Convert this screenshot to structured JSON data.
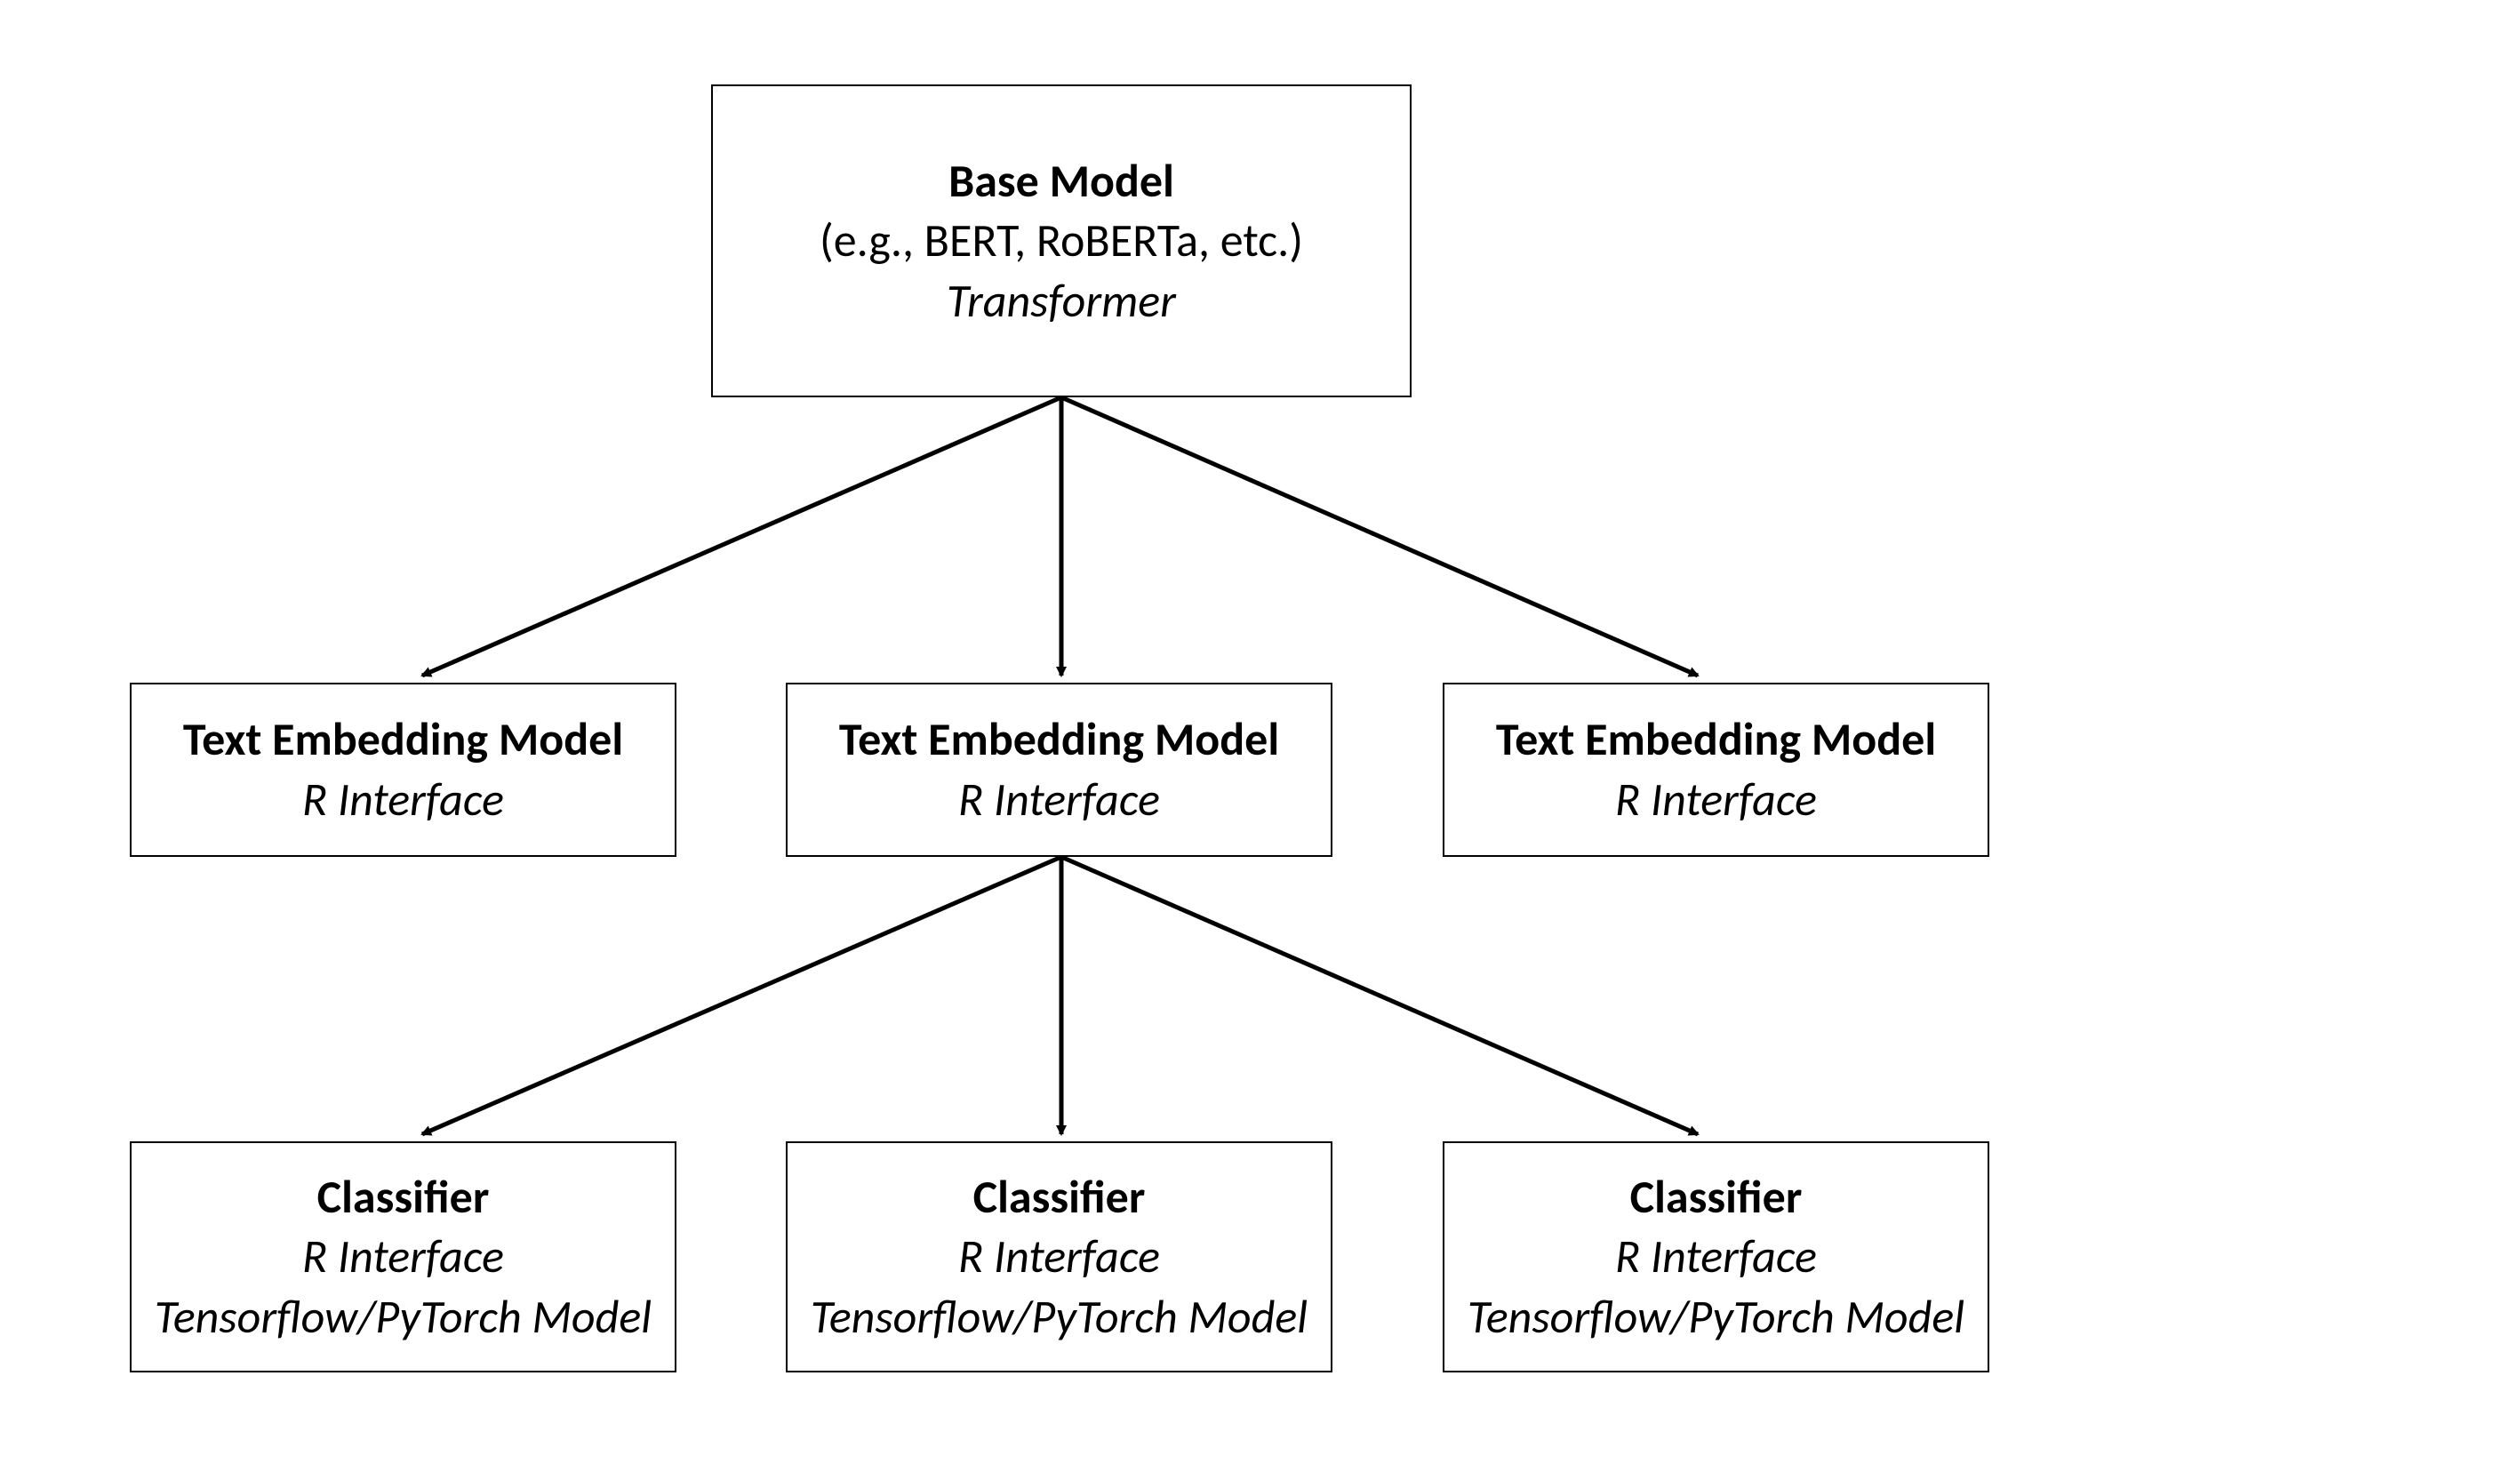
{
  "nodes": {
    "base": {
      "title": "Base Model",
      "subtitle": "(e.g., BERT, RoBERTa, etc.)",
      "italic": "Transformer"
    },
    "embed1": {
      "title": "Text Embedding Model",
      "italic": "R Interface"
    },
    "embed2": {
      "title": "Text Embedding Model",
      "italic": "R Interface"
    },
    "embed3": {
      "title": "Text Embedding Model",
      "italic": "R Interface"
    },
    "clf1": {
      "title": "Classifier",
      "italic1": "R Interface",
      "italic2": "Tensorflow/PyTorch Model"
    },
    "clf2": {
      "title": "Classifier",
      "italic1": "R Interface",
      "italic2": "Tensorflow/PyTorch Model"
    },
    "clf3": {
      "title": "Classifier",
      "italic1": "R Interface",
      "italic2": "Tensorflow/PyTorch Model"
    }
  }
}
